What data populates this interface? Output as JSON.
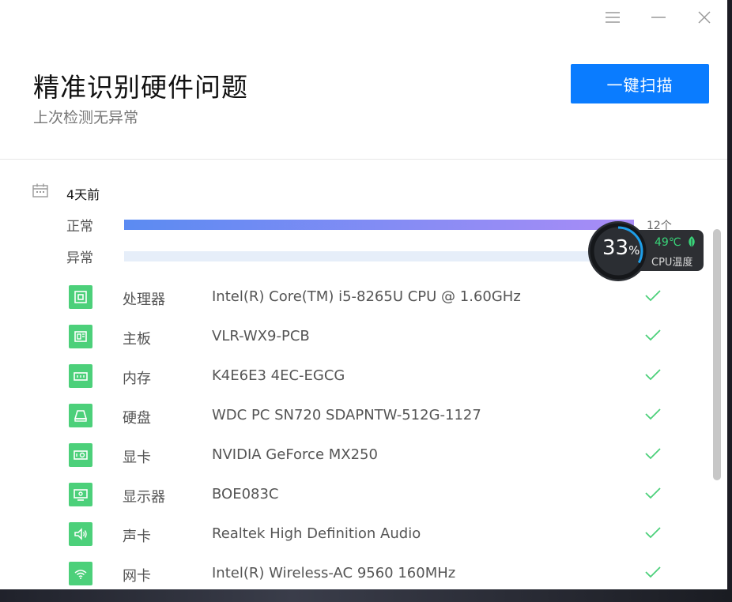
{
  "titlebar": {
    "menu_icon": "hamburger-menu-icon",
    "minimize_icon": "minimize-icon",
    "close_icon": "close-icon"
  },
  "header": {
    "title": "精准识别硬件问题",
    "subtitle": "上次检测无异常",
    "scan_button_label": "一键扫描"
  },
  "summary": {
    "date_label": "4天前",
    "normal_label": "正常",
    "abnormal_label": "异常",
    "normal_count": "12个",
    "normal_fraction": 1.0,
    "abnormal_fraction": 0.0
  },
  "hardware": [
    {
      "icon": "cpu-icon",
      "name": "处理器",
      "value": "Intel(R) Core(TM) i5-8265U CPU @ 1.60GHz"
    },
    {
      "icon": "motherboard-icon",
      "name": "主板",
      "value": "VLR-WX9-PCB"
    },
    {
      "icon": "memory-icon",
      "name": "内存",
      "value": "K4E6E3 4EC-EGCG"
    },
    {
      "icon": "disk-icon",
      "name": "硬盘",
      "value": "WDC PC SN720 SDAPNTW-512G-1127"
    },
    {
      "icon": "graphics-card-icon",
      "name": "显卡",
      "value": "NVIDIA GeForce MX250"
    },
    {
      "icon": "monitor-icon",
      "name": "显示器",
      "value": "BOE083C"
    },
    {
      "icon": "speaker-icon",
      "name": "声卡",
      "value": "Realtek High Definition Audio"
    },
    {
      "icon": "wifi-icon",
      "name": "网卡",
      "value": "Intel(R) Wireless-AC 9560 160MHz"
    }
  ],
  "cpu_widget": {
    "usage": "33",
    "usage_unit": "%",
    "temperature": "49℃",
    "temperature_label": "CPU温度"
  },
  "colors": {
    "accent": "#0a7cff",
    "ok_green": "#4cd07a",
    "bar_start": "#5b8bf2",
    "bar_end": "#a98cf6"
  }
}
